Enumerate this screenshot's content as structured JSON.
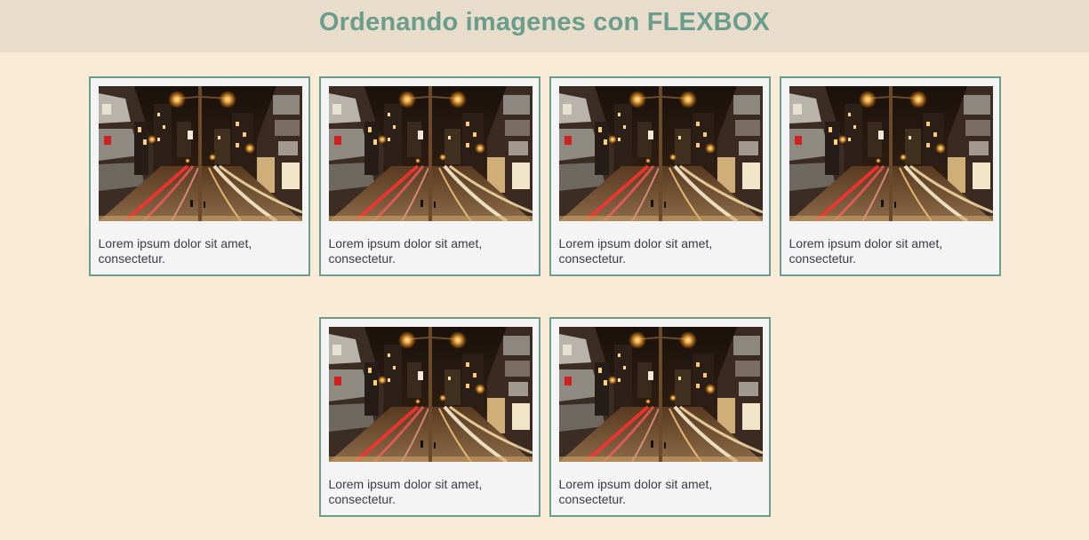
{
  "header": {
    "title": "Ordenando imagenes con FLEXBOX"
  },
  "colors": {
    "background": "#faebd7",
    "header_background": "#e8dccb",
    "accent": "#6a9d8c",
    "card_background": "#f4f4f4",
    "caption_text": "#3a3a4a"
  },
  "gallery": {
    "cards": [
      {
        "image": "night-street-photo",
        "caption": "Lorem ipsum dolor sit amet, consectetur."
      },
      {
        "image": "night-street-photo",
        "caption": "Lorem ipsum dolor sit amet, consectetur."
      },
      {
        "image": "night-street-photo",
        "caption": "Lorem ipsum dolor sit amet, consectetur."
      },
      {
        "image": "night-street-photo",
        "caption": "Lorem ipsum dolor sit amet, consectetur."
      },
      {
        "image": "night-street-photo",
        "caption": "Lorem ipsum dolor sit amet, consectetur."
      },
      {
        "image": "night-street-photo",
        "caption": "Lorem ipsum dolor sit amet, consectetur."
      }
    ]
  }
}
